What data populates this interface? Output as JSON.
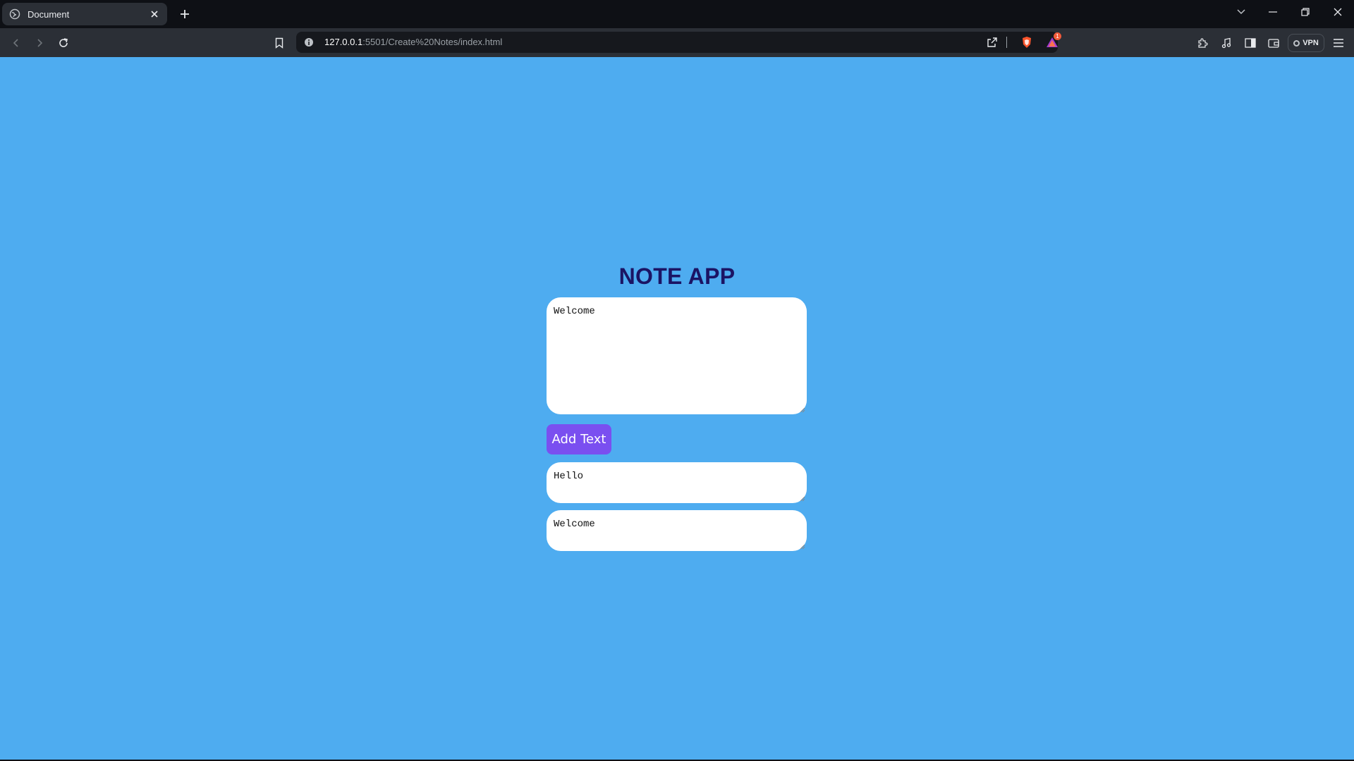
{
  "browser": {
    "tab_title": "Document",
    "url_host": "127.0.0.1",
    "url_path": ":5501/Create%20Notes/index.html",
    "rewards_badge": "1",
    "vpn_label": "VPN"
  },
  "app": {
    "title": "NOTE APP",
    "main_note_value": "Welcome",
    "add_button_label": "Add Text",
    "notes": [
      "Hello",
      "Welcome"
    ]
  },
  "colors": {
    "page_background": "#4eacf0",
    "title": "#1b1464",
    "button": "#7a4ff0"
  }
}
